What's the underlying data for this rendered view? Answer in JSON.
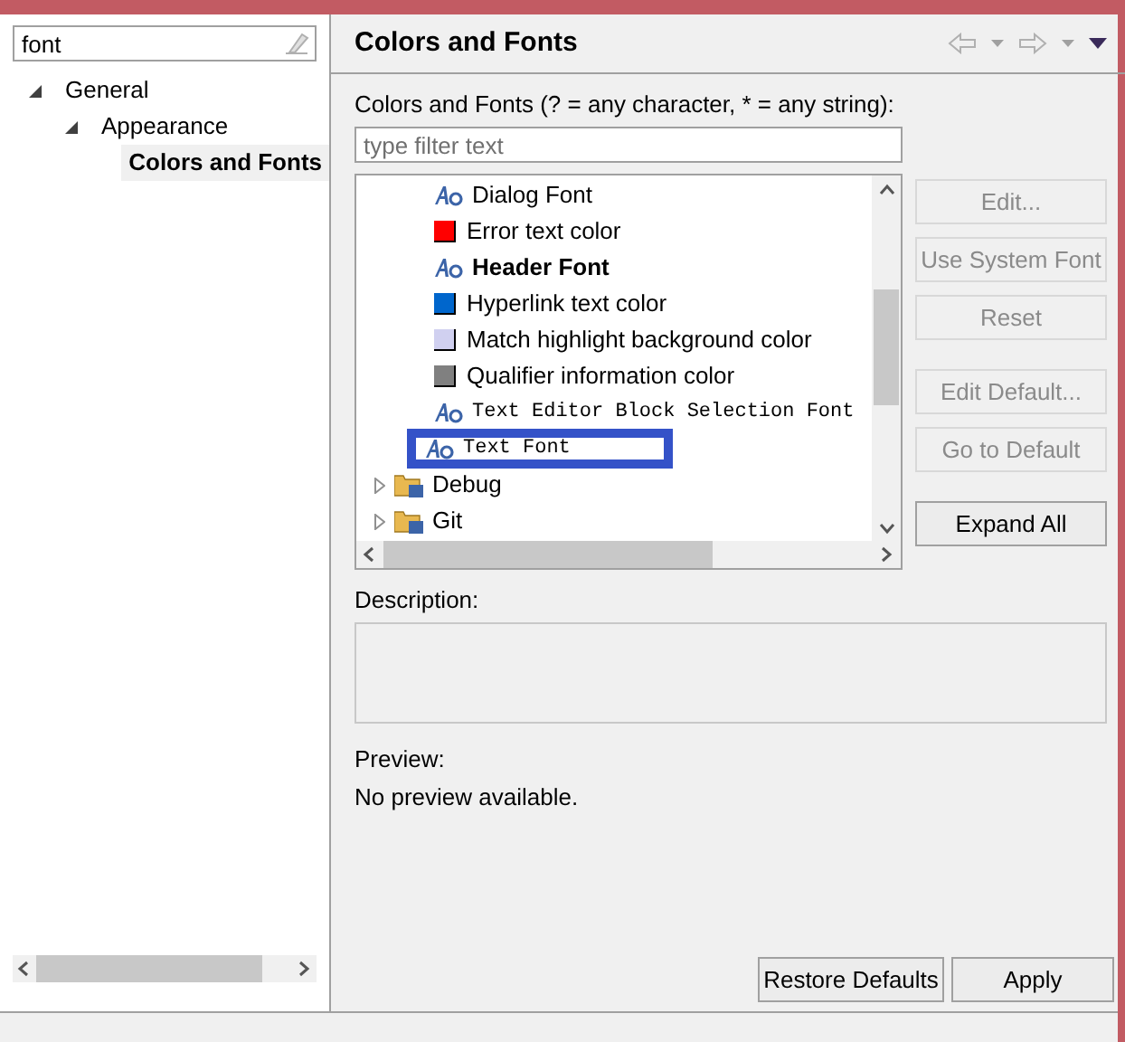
{
  "sidebar": {
    "search": {
      "value": "font"
    },
    "tree": [
      {
        "label": "General",
        "expanded": true,
        "selected": false,
        "children": [
          {
            "label": "Appearance",
            "expanded": true,
            "selected": false,
            "children": [
              {
                "label": "Colors and Fonts",
                "selected": true
              }
            ]
          }
        ]
      }
    ]
  },
  "page": {
    "title": "Colors and Fonts",
    "filter_label": "Colors and Fonts (? = any character, * = any string):",
    "filter": {
      "placeholder": "type filter text"
    },
    "items": [
      {
        "kind": "font",
        "label": "Dialog Font",
        "bold": false,
        "mono": false,
        "highlighted": false
      },
      {
        "kind": "color",
        "label": "Error text color",
        "color": "#ff0000"
      },
      {
        "kind": "font",
        "label": "Header Font",
        "bold": true,
        "mono": false,
        "highlighted": false
      },
      {
        "kind": "color",
        "label": "Hyperlink text color",
        "color": "#0066cc"
      },
      {
        "kind": "color",
        "label": "Match highlight background color",
        "color": "#d0d0f0"
      },
      {
        "kind": "color",
        "label": "Qualifier information color",
        "color": "#808080"
      },
      {
        "kind": "font",
        "label": "Text Editor Block Selection Font",
        "bold": false,
        "mono": true,
        "highlighted": false
      },
      {
        "kind": "font",
        "label": "Text Font",
        "bold": false,
        "mono": true,
        "highlighted": true
      },
      {
        "kind": "folder",
        "label": "Debug",
        "expanded": false
      },
      {
        "kind": "folder",
        "label": "Git",
        "expanded": false
      }
    ],
    "buttons": [
      {
        "label": "Edit...",
        "disabled": true
      },
      {
        "label": "Use System Font",
        "disabled": true
      },
      {
        "label": "Reset",
        "disabled": true
      },
      {
        "label": "Edit Default...",
        "disabled": true
      },
      {
        "label": "Go to Default",
        "disabled": true
      },
      {
        "label": "Expand All",
        "disabled": false
      }
    ],
    "description_label": "Description:",
    "preview_label": "Preview:",
    "preview_text": "No preview available.",
    "footer_buttons": [
      "Restore Defaults",
      "Apply"
    ]
  }
}
